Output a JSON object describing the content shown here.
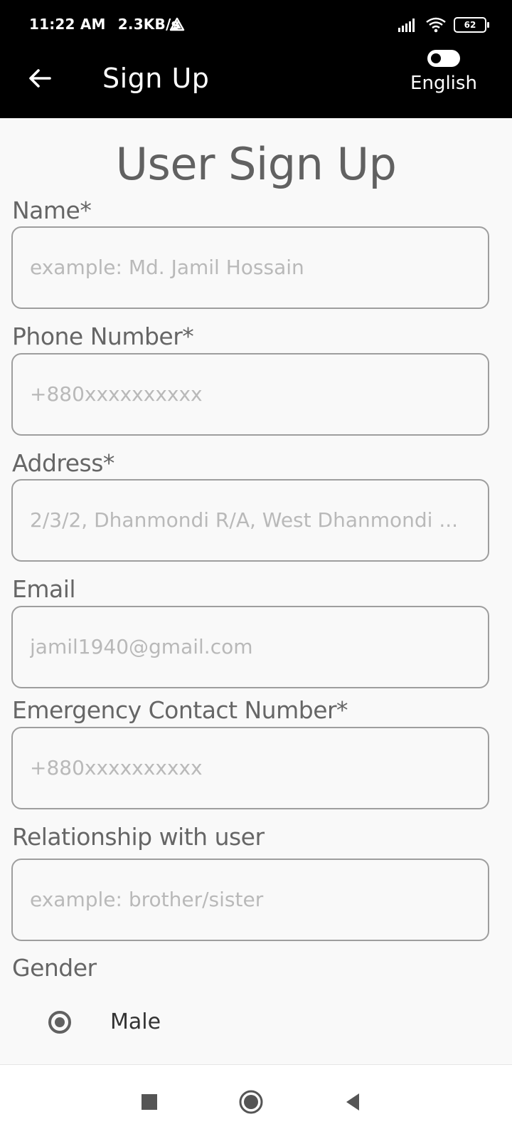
{
  "status_bar": {
    "time": "11:22 AM",
    "speed": "2.3KB/s",
    "battery": "62"
  },
  "app_bar": {
    "title": "Sign Up",
    "language_label": "English",
    "back_icon": "arrow-left-icon",
    "toggle_icon": "language-toggle"
  },
  "form": {
    "title": "User Sign Up",
    "fields": [
      {
        "label": "Name*",
        "placeholder": "example: Md. Jamil Hossain"
      },
      {
        "label": "Phone Number*",
        "placeholder": "+880xxxxxxxxxx"
      },
      {
        "label": "Address*",
        "placeholder": "2/3/2, Dhanmondi R/A, West Dhanmondi ..."
      },
      {
        "label": "Email",
        "placeholder": "jamil1940@gmail.com"
      },
      {
        "label": "Emergency Contact Number*",
        "placeholder": "+880xxxxxxxxxx"
      },
      {
        "label": "Relationship with user",
        "placeholder": "example: brother/sister"
      }
    ],
    "gender": {
      "label": "Gender",
      "options": [
        {
          "label": "Male",
          "selected": true
        }
      ]
    }
  },
  "nav_bar": {
    "recent_icon": "square-icon",
    "home_icon": "circle-icon",
    "back_icon": "triangle-back-icon"
  }
}
